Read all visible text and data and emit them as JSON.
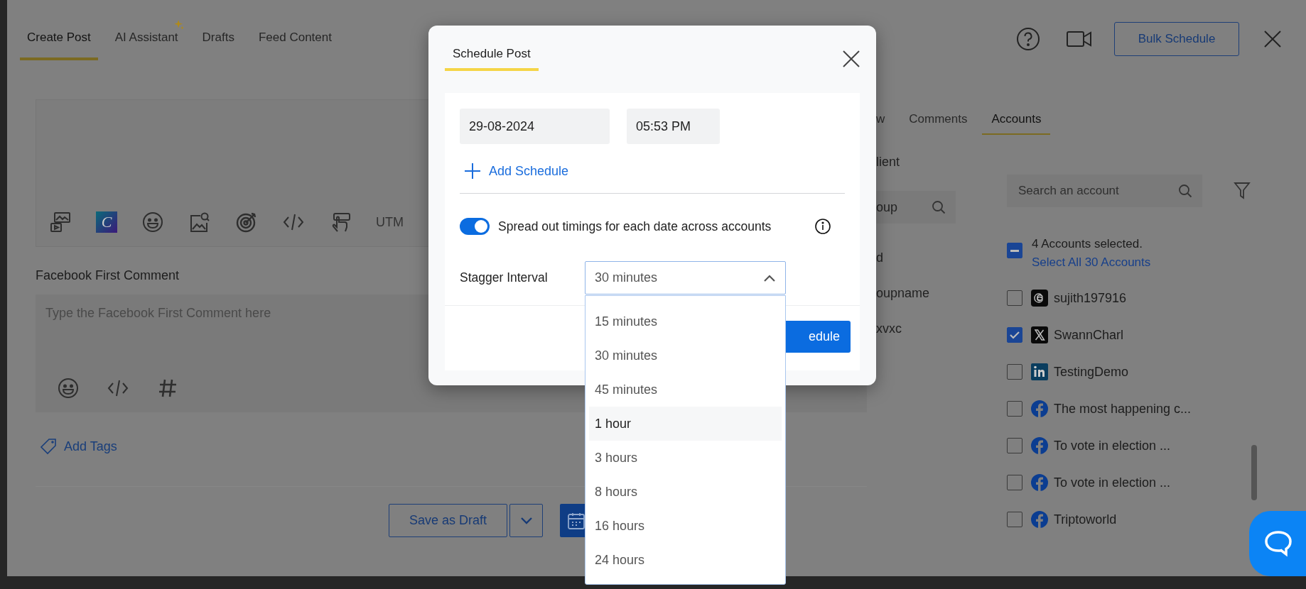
{
  "header": {
    "tabs": [
      {
        "label": "Create Post",
        "selected": true,
        "sparkle": false
      },
      {
        "label": "AI Assistant",
        "selected": false,
        "sparkle": true
      },
      {
        "label": "Drafts",
        "selected": false,
        "sparkle": false
      },
      {
        "label": "Feed Content",
        "selected": false,
        "sparkle": false
      }
    ],
    "bulk_button": "Bulk Schedule"
  },
  "editor": {
    "toolbar": [
      {
        "kind": "media"
      },
      {
        "kind": "canva",
        "text": "C"
      },
      {
        "kind": "emoji"
      },
      {
        "kind": "image-search"
      },
      {
        "kind": "target"
      },
      {
        "kind": "code"
      },
      {
        "kind": "pointer"
      },
      {
        "kind": "text",
        "text": "UTM"
      }
    ]
  },
  "first_comment": {
    "label": "Facebook First Comment",
    "placeholder": "Type the Facebook First Comment here",
    "toolbar": [
      {
        "kind": "emoji"
      },
      {
        "kind": "code"
      },
      {
        "kind": "hash"
      }
    ]
  },
  "add_tags": "Add Tags",
  "footer": {
    "draft_button": "Save as Draft"
  },
  "side_tabs": [
    {
      "label": "w",
      "selected": false
    },
    {
      "label": "Comments",
      "selected": false
    },
    {
      "label": "Accounts",
      "selected": true
    }
  ],
  "middle_panel": {
    "label": "lient",
    "search_placeholder": "oup",
    "items": [
      "d",
      "oupname",
      "xvxc"
    ]
  },
  "accounts": {
    "search_placeholder": "Search an account",
    "select_all_indeterminate": true,
    "selected_text": "4 Accounts selected.",
    "select_all": "Select All 30 Accounts",
    "items": [
      {
        "name": "sujith197916",
        "kind": "threads",
        "checked": false
      },
      {
        "name": "SwannCharl",
        "kind": "x",
        "checked": true
      },
      {
        "name": "TestingDemo",
        "kind": "linkedin",
        "checked": false
      },
      {
        "name": "The most happening c...",
        "kind": "facebook",
        "checked": false
      },
      {
        "name": "To vote in election ...",
        "kind": "facebook",
        "checked": false
      },
      {
        "name": "To vote in election ...",
        "kind": "facebook",
        "checked": false
      },
      {
        "name": "Triptoworld",
        "kind": "facebook",
        "checked": false
      }
    ]
  },
  "modal": {
    "title": "Schedule Post",
    "date": "29-08-2024",
    "time": "05:53 PM",
    "add_schedule": "Add Schedule",
    "spread": {
      "label": "Spread out timings for each date across accounts",
      "on": true
    },
    "stagger": {
      "label": "Stagger Interval",
      "value": "30 minutes",
      "expanded": true,
      "options": [
        {
          "label": "15 minutes",
          "hovered": false
        },
        {
          "label": "30 minutes",
          "hovered": false
        },
        {
          "label": "45 minutes",
          "hovered": false
        },
        {
          "label": "1 hour",
          "hovered": true
        },
        {
          "label": "3 hours",
          "hovered": false
        },
        {
          "label": "8 hours",
          "hovered": false
        },
        {
          "label": "16 hours",
          "hovered": false
        },
        {
          "label": "24 hours",
          "hovered": false
        }
      ]
    },
    "schedule_button": "edule"
  }
}
